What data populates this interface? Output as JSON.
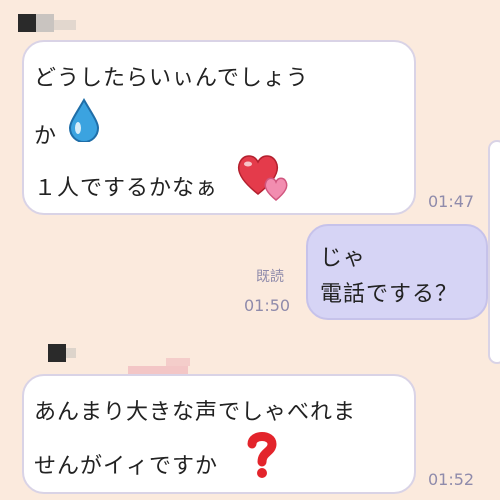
{
  "messages": [
    {
      "lines": [
        "どうしたらいぃんでしょう",
        "か",
        "１人でするかなぁ"
      ],
      "time": "01:47"
    },
    {
      "lines": [
        "じゃ",
        "電話でする？"
      ],
      "read": "既読",
      "time": "01:50"
    },
    {
      "lines": [
        "あんまり大きな声でしゃべれま",
        "せんがイィですか"
      ],
      "time": "01:52"
    }
  ],
  "icons": [
    "water-drop-icon",
    "two-hearts-icon",
    "red-question-icon"
  ],
  "colors": {
    "background": "#fbeadd",
    "incoming_bubble": "#ffffff",
    "outgoing_bubble": "#d6d4f5",
    "timestamp": "#8f8bab"
  }
}
